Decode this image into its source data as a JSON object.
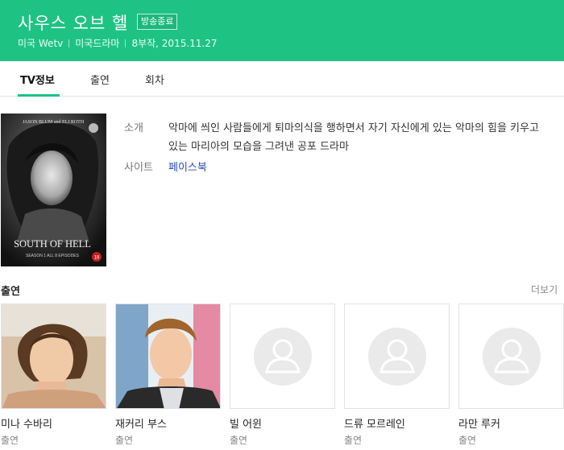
{
  "header": {
    "title": "사우스 오브 헬",
    "status_badge": "방송종료",
    "channel": "미국 Wetv",
    "genre": "미국드라마",
    "episodes_date": "8부작, 2015.11.27",
    "bg_color": "#1ec383"
  },
  "tabs": [
    {
      "label": "TV정보",
      "active": true
    },
    {
      "label": "출연",
      "active": false
    },
    {
      "label": "회차",
      "active": false
    }
  ],
  "info": {
    "intro_label": "소개",
    "intro_text": "악마에 씌인 사람들에게 퇴마의식을 행하면서 자기 자신에게 있는 악마의 힘을 키우고 있는 마리아의 모습을 그려낸 공포 드라마",
    "site_label": "사이트",
    "site_link": "페이스북"
  },
  "poster": {
    "credit": "JASON BLUM and ELI ROTH",
    "title": "SOUTH OF HELL",
    "subtitle": "SEASON 1 ALL 8 EPISODES",
    "rating": "18"
  },
  "cast": {
    "heading": "출연",
    "more_label": "더보기",
    "members": [
      {
        "name": "미나 수바리",
        "role": "출연",
        "photo": "actress-photo"
      },
      {
        "name": "재커리 부스",
        "role": "출연",
        "photo": "actor-photo"
      },
      {
        "name": "빌 어윈",
        "role": "출연",
        "photo": "placeholder"
      },
      {
        "name": "드류 모르레인",
        "role": "출연",
        "photo": "placeholder"
      },
      {
        "name": "라만 루커",
        "role": "출연",
        "photo": "placeholder"
      }
    ]
  }
}
